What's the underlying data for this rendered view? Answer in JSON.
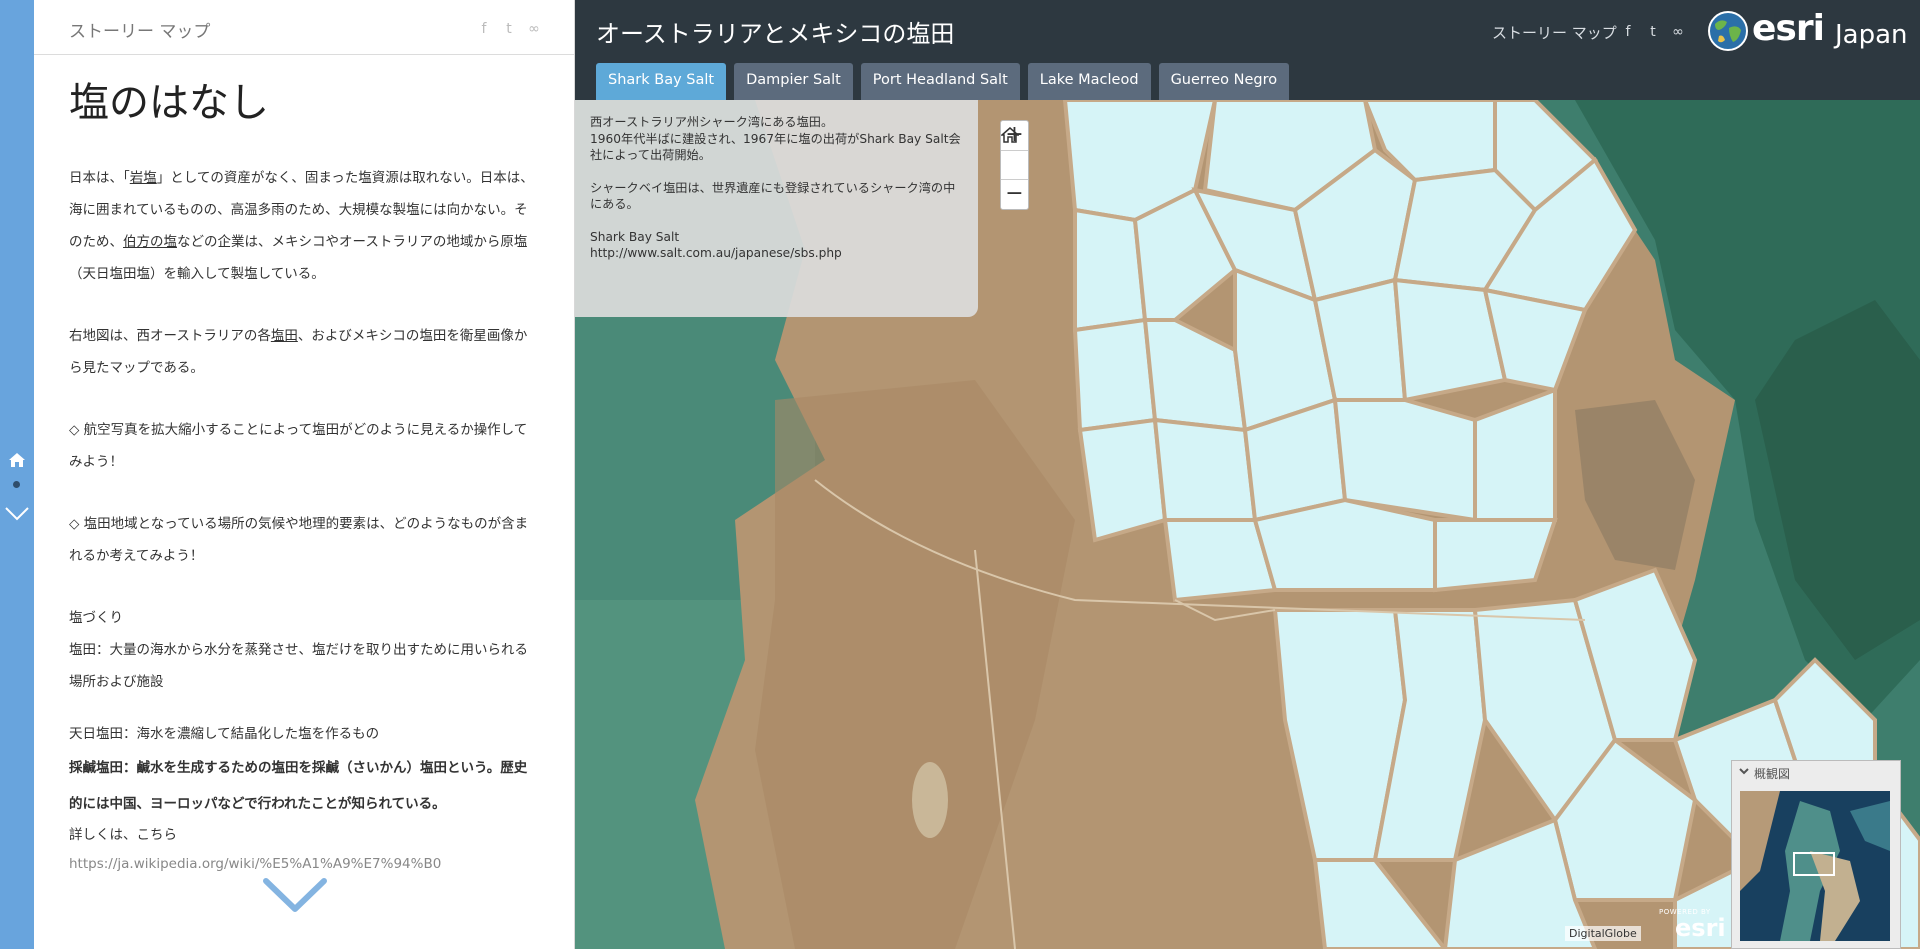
{
  "side_panel": {
    "app_label": "ストーリー マップ",
    "title": "塩のはなし",
    "para1_a": "日本は、「",
    "para1_link1": "岩塩",
    "para1_b": "」としての資産がなく、固まった塩資源は取れない。日本は、海に囲まれているものの、高温多雨のため、大規模な製塩には向かない。そのため、",
    "para1_link2": "伯方の塩",
    "para1_c": "などの企業は、メキシコやオーストラリアの地域から原塩（天日塩田塩）を輸入して製塩している。",
    "para2_a": "右地図は、西オーストラリアの各",
    "para2_link": "塩田",
    "para2_b": "、およびメキシコの塩田を衛星画像から見たマップである。",
    "para3": "◇ 航空写真を拡大縮小することによって塩田がどのように見えるか操作してみよう！",
    "para4": "◇ 塩田地域となっている場所の気候や地理的要素は、どのようなものが含まれるか考えてみよう！",
    "para5_h": "塩づくり",
    "para5": "塩田：大量の海水から水分を蒸発させ、塩だけを取り出すために用いられる場所および施設",
    "para6": "天日塩田：海水を濃縮して結晶化した塩を作るもの",
    "para7": "採鹹塩田：鹹水を生成するための塩田を採鹹（さいかん）塩田という。歴史的には中国、ヨーロッパなどで行われたことが知られている。",
    "para8": "詳しくは、こちら",
    "link": "https://ja.wikipedia.org/wiki/%E5%A1%A9%E7%94%B0"
  },
  "header": {
    "title": "オーストラリアとメキシコの塩田",
    "app_label": "ストーリー マップ",
    "logo_text": "esri",
    "logo_country": "Japan"
  },
  "tabs": [
    {
      "label": "Shark Bay Salt",
      "active": true
    },
    {
      "label": "Dampier Salt",
      "active": false
    },
    {
      "label": "Port Headland Salt",
      "active": false
    },
    {
      "label": "Lake Macleod",
      "active": false
    },
    {
      "label": "Guerreo Negro",
      "active": false
    }
  ],
  "info_panel": {
    "line1": "西オーストラリア州シャーク湾にある塩田。",
    "line2": "1960年代半ばに建設され、1967年に塩の出荷がShark Bay Salt会社によって出荷開始。",
    "line3": "シャークベイ塩田は、世界遺産にも登録されているシャーク湾の中にある。",
    "line4": "Shark Bay Salt",
    "line5": "http://www.salt.com.au/japanese/sbs.php"
  },
  "zoom": {
    "in": "+",
    "home_icon": "home-icon",
    "out": "−"
  },
  "overview": {
    "label": "概観図"
  },
  "attribution": "DigitalGlobe",
  "powered_by": {
    "top": "POWERED BY",
    "brand": "esri"
  },
  "colors": {
    "rail": "#68a4dd",
    "topbar": "#2d3840",
    "tab": "#5c6b7d",
    "tab_active": "#5ea9d8",
    "sea": "#3d7f70",
    "land": "#b39572",
    "salt_pond": "#d6f4f7"
  }
}
